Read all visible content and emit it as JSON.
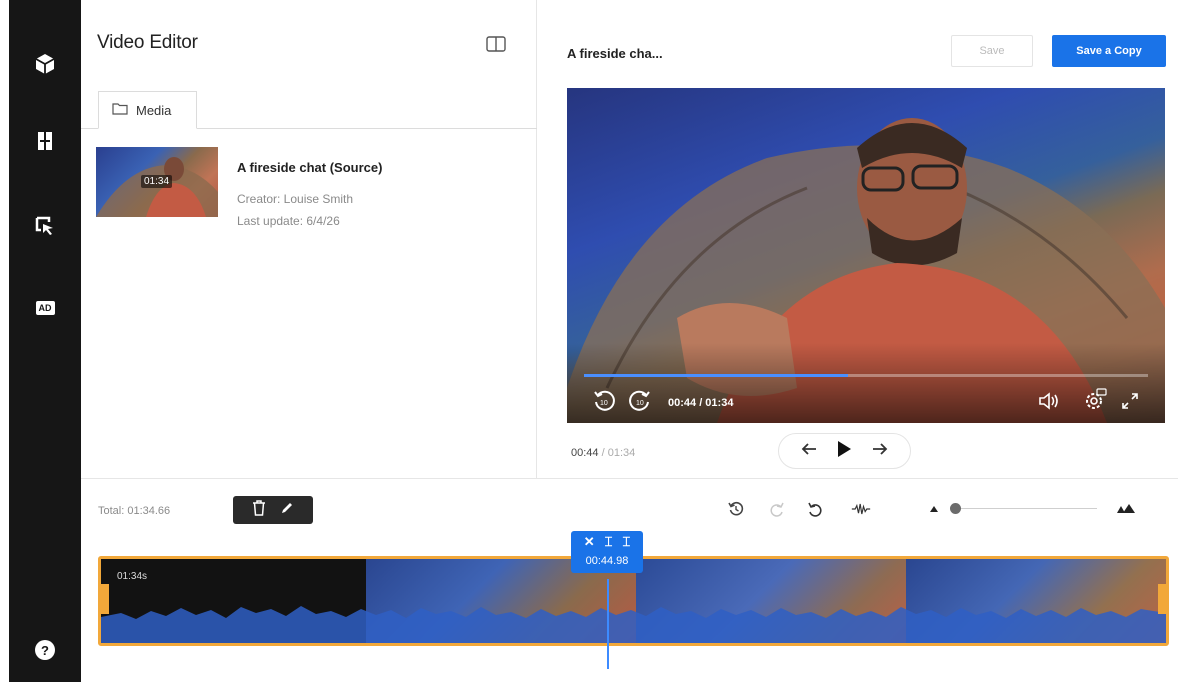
{
  "sidebar": {
    "items": [
      {
        "icon": "cube-icon"
      },
      {
        "icon": "book-icon"
      },
      {
        "icon": "cursor-click-icon"
      },
      {
        "icon": "audio-description-icon",
        "label": "AD"
      }
    ],
    "help_icon": "help-icon"
  },
  "media_panel": {
    "title": "Video Editor",
    "tab_label": "Media",
    "item": {
      "title": "A fireside chat (Source)",
      "creator": "Creator: Louise Smith",
      "last_update": "Last update: 6/4/26",
      "duration": "01:34"
    }
  },
  "preview": {
    "title": "A fireside cha...",
    "save_label": "Save",
    "save_copy_label": "Save a Copy",
    "player_time": "00:44 / 01:34",
    "progress": 0.468,
    "current_time": "00:44",
    "separator": " / ",
    "total_time": "01:34"
  },
  "timeline": {
    "total": "Total: 01:34.66",
    "segment_label": "01:34s",
    "playhead_time": "00:44.98",
    "zoom_level": 0.05
  },
  "colors": {
    "accent": "#1a73e8",
    "track_border": "#f2a83a",
    "rail": "#161616"
  }
}
